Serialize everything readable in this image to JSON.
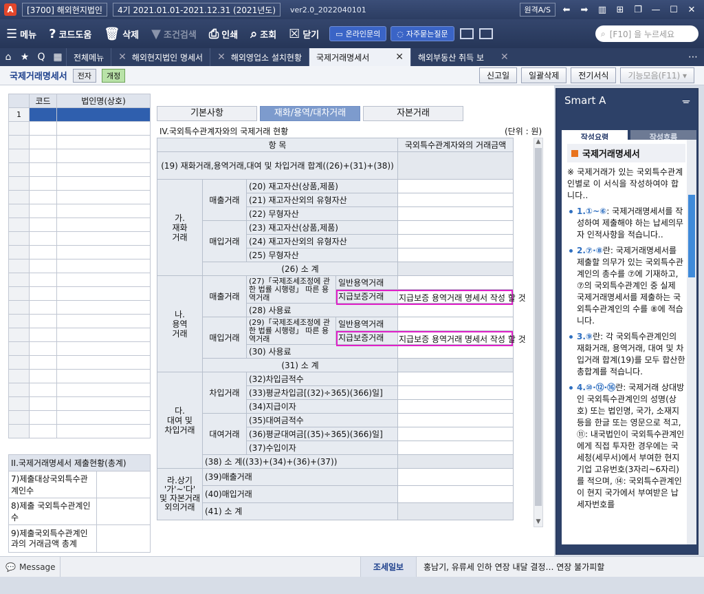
{
  "titlebar": {
    "company": "[3700] 해외현지법인",
    "period": "4기 2021.01.01-2021.12.31 (2021년도)",
    "version": "ver2.0_2022040101",
    "remote": "원격A/S"
  },
  "toolbar": {
    "menu": "메뉴",
    "codehelp": "코드도움",
    "delete": "삭제",
    "filter": "조건검색",
    "print": "인쇄",
    "lookup": "조회",
    "close": "닫기",
    "online": "온라인문의",
    "faq": "자주묻는질문",
    "search_placeholder": "[F10] 을 누르세요"
  },
  "tabs": [
    "전체메뉴",
    "해외현지법인 명세서",
    "해외영업소 설치현황",
    "국제거래명세서",
    "해외부동산 취득 보"
  ],
  "subbar": {
    "title": "국제거래명세서",
    "badge1": "전자",
    "badge2": "개정",
    "btn_new": "신고일",
    "btn_delall": "일괄삭제",
    "btn_elec": "전기서식",
    "btn_func": "기능모음(F11)"
  },
  "left": {
    "col_code": "코드",
    "col_name": "법인명(상호)",
    "row1": "1"
  },
  "summary": {
    "title": "II.국제거래명세서 제출현황(총계)",
    "r7": "7)제출대상국외특수관계인수",
    "r8": "8)제출 국외특수관계인 수",
    "r9": "9)제출국외특수관계인과의 거래금액 총계"
  },
  "formtabs": [
    "기본사항",
    "재화/용역/대차거래",
    "자본거래"
  ],
  "section": {
    "title": "IV.국외특수관계자와의 국제거래 현황",
    "unit": "(단위 : 원)"
  },
  "table": {
    "h_item": "항                목",
    "h_amount": "국외특수관계자와의 거래금액",
    "r19": "(19) 재화거래,용역거래,대여 및 차입거래 합계((26)+(31)+(38))",
    "ga": "가.\n재화\n거래",
    "sales": "매출거래",
    "purch": "매입거래",
    "r20": "(20) 재고자산(상품,제품)",
    "r21": "(21) 재고자산외의 유형자산",
    "r22": "(22) 무형자산",
    "r23": "(23) 재고자산(상품,제품)",
    "r24": "(24) 재고자산외의 유형자산",
    "r25": "(25) 무형자산",
    "r26": "(26) 소          계",
    "na": "나.\n용역\n거래",
    "r27": "(27)「국제조세조정에 관한 법률 시행령」 따른 용역거래",
    "general": "일반용역거래",
    "pay": "지급보증거래",
    "paynote": "지급보증 용역거래 명세서 작성 할 것",
    "r28": "(28) 사용료",
    "r29": "(29)「국제조세조정에 관한 법률 시행령」 따른 용역거래",
    "r30": "(30) 사용료",
    "r31": "(31) 소          계",
    "da": "다.\n대여 및\n차입거래",
    "borrow": "차입거래",
    "lend": "대여거래",
    "r32": "(32)차입금적수",
    "r33": "(33)평균차입금[(32)÷365)(366)일]",
    "r34": "(34)지급이자",
    "r35": "(35)대여금적수",
    "r36": "(36)평균대여금[(35)÷365)(366)일]",
    "r37": "(37)수입이자",
    "r38": "(38) 소 계((33)+(34)+(36)+(37))",
    "ra": "라.상기 '가'~'다' 및 자본거래 외의거래",
    "r39": "(39)매출거래",
    "r40": "(40)매입거래",
    "r41": "(41) 소 계"
  },
  "smart": {
    "title": "Smart A",
    "tab1": "작성요령",
    "tab2": "작성흐름",
    "doc": "국제거래명세서",
    "intro": "※ 국제거래가 있는 국외특수관계인별로 이 서식을 작성하여야 합니다..",
    "items": [
      {
        "num": "1.①~⑥",
        "text": ": 국제거래명세서를 작성하여 제출해야 하는 납세의무자 인적사항을 적습니다.."
      },
      {
        "num": "2.⑦·⑧",
        "text": "란: 국제거래명세서를 제출할 의무가 있는 국외특수관계인의 총수를 ⑦에 기재하고, ⑦의 국외특수관계인 중 실제 국제거래명세서를 제출하는 국외특수관계인의 수를 ⑧에 적습니다."
      },
      {
        "num": "3.⑨",
        "text": "란: 각 국외특수관계인의 재화거래, 용역거래, 대여 및 차입거래 합계(19)를 모두 합산한 총합계를 적습니다."
      },
      {
        "num": "4.⑩·⑫·⑯",
        "text": "란: 국제거래 상대방인 국외특수관계인의 성명(상호) 또는 법인명, 국가, 소재지 등을 한글 또는 영문으로 적고, ⑪: 내국법인이 국외특수관계인에게 직접 투자한 경우에는 국세청(세무서)에서 부여한 현지기업 고유번호(3자리~6자리)를 적으며, ⑭: 국외특수관계인이 현지 국가에서 부여받은 납세자번호를"
      }
    ]
  },
  "status": {
    "message": "Message",
    "news_label": "조세일보",
    "news": "홍남기, 유류세 인하 연장 내달 결정… 연장 불가피할"
  }
}
